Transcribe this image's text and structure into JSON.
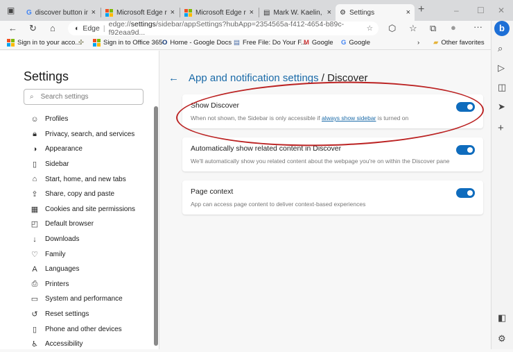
{
  "tabs": [
    {
      "label": "discover button in",
      "icon": "google-icon"
    },
    {
      "label": "Microsoft Edge rele",
      "icon": "microsoft-icon"
    },
    {
      "label": "Microsoft Edge rele",
      "icon": "microsoft-icon"
    },
    {
      "label": "Mark W. Kaelin, Au",
      "icon": "page-icon"
    },
    {
      "label": "Settings",
      "icon": "gear-icon",
      "active": true
    }
  ],
  "address": {
    "prefix": "Edge",
    "scheme": "edge://",
    "bold": "settings",
    "rest": "/sidebar/appSettings?hubApp=2354565a-f412-4654-b89c-f92eaa9d..."
  },
  "favorites": [
    {
      "label": "Sign in to your acco..."
    },
    {
      "label": ""
    },
    {
      "label": "Sign in to Office 365"
    },
    {
      "label": "Home - Google Docs"
    },
    {
      "label": "Free File: Do Your F..."
    },
    {
      "label": "Google"
    },
    {
      "label": "Google"
    }
  ],
  "other_favorites": "Other favorites",
  "settings": {
    "title": "Settings",
    "search_placeholder": "Search settings",
    "nav": [
      {
        "label": "Profiles",
        "icon": "profile-icon"
      },
      {
        "label": "Privacy, search, and services",
        "icon": "lock-icon"
      },
      {
        "label": "Appearance",
        "icon": "appearance-icon"
      },
      {
        "label": "Sidebar",
        "icon": "sidebar-icon"
      },
      {
        "label": "Start, home, and new tabs",
        "icon": "home-icon"
      },
      {
        "label": "Share, copy and paste",
        "icon": "share-icon"
      },
      {
        "label": "Cookies and site permissions",
        "icon": "cookies-icon"
      },
      {
        "label": "Default browser",
        "icon": "browser-icon"
      },
      {
        "label": "Downloads",
        "icon": "download-icon"
      },
      {
        "label": "Family",
        "icon": "family-icon"
      },
      {
        "label": "Languages",
        "icon": "language-icon"
      },
      {
        "label": "Printers",
        "icon": "printer-icon"
      },
      {
        "label": "System and performance",
        "icon": "system-icon"
      },
      {
        "label": "Reset settings",
        "icon": "reset-icon"
      },
      {
        "label": "Phone and other devices",
        "icon": "phone-icon"
      },
      {
        "label": "Accessibility",
        "icon": "accessibility-icon"
      }
    ]
  },
  "page": {
    "breadcrumb_parent": "App and notification settings",
    "breadcrumb_sep": "/",
    "breadcrumb_current": "Discover",
    "cards": [
      {
        "title": "Show Discover",
        "desc_before": "When not shown, the Sidebar is only accessible if ",
        "link": "always show sidebar",
        "desc_after": " is turned on",
        "on": true
      },
      {
        "title": "Automatically show related content in Discover",
        "desc": "We'll automatically show you related content about the webpage you're on within the Discover pane",
        "on": true
      },
      {
        "title": "Page context",
        "desc": "App can access page content to deliver context-based experiences",
        "on": true
      }
    ]
  },
  "colors": {
    "accent": "#0f6cbd",
    "annotation": "#bb2222"
  }
}
